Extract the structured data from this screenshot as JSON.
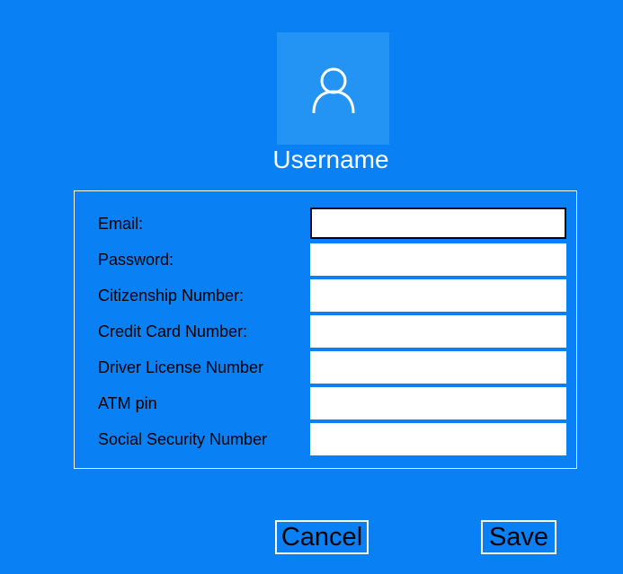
{
  "profile": {
    "username": "Username",
    "avatar_icon": "user-icon"
  },
  "form": {
    "fields": [
      {
        "label": "Email:",
        "value": ""
      },
      {
        "label": "Password:",
        "value": ""
      },
      {
        "label": "Citizenship Number:",
        "value": ""
      },
      {
        "label": "Credit Card Number:",
        "value": ""
      },
      {
        "label": "Driver License Number",
        "value": ""
      },
      {
        "label": "ATM pin",
        "value": ""
      },
      {
        "label": "Social Security Number",
        "value": ""
      }
    ]
  },
  "actions": {
    "cancel_label": "Cancel",
    "save_label": "Save"
  },
  "colors": {
    "background": "#0a80f5",
    "avatar_background": "#2394f3",
    "field_background": "#ffffff",
    "border": "#ffffff"
  }
}
